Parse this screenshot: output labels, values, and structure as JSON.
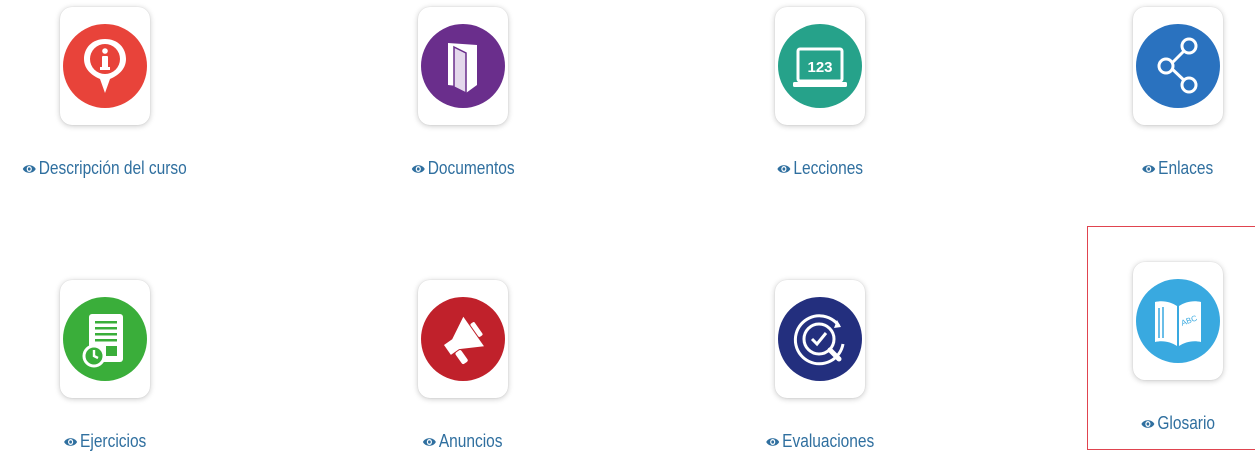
{
  "tools": {
    "descripcion": {
      "label": "Descripción del curso",
      "icon": "info-pin-icon",
      "color": "#e8433a"
    },
    "documentos": {
      "label": "Documentos",
      "icon": "folder-icon",
      "color": "#6a2e8c"
    },
    "lecciones": {
      "label": "Lecciones",
      "icon": "numbered-board-icon",
      "color": "#26a28a",
      "badge": "123"
    },
    "enlaces": {
      "label": "Enlaces",
      "icon": "share-link-icon",
      "color": "#2a72bf"
    },
    "ejercicios": {
      "label": "Ejercicios",
      "icon": "exercise-clipboard-icon",
      "color": "#3aae3a"
    },
    "anuncios": {
      "label": "Anuncios",
      "icon": "megaphone-icon",
      "color": "#c0212b"
    },
    "evaluaciones": {
      "label": "Evaluaciones",
      "icon": "checkmark-magnifier-icon",
      "color": "#232f7e"
    },
    "glosario": {
      "label": "Glosario",
      "icon": "open-book-icon",
      "color": "#39a9e0",
      "badge": "ABC"
    }
  },
  "icons": {
    "visibility": "eye-icon"
  },
  "highlight_color": "#e0444f"
}
